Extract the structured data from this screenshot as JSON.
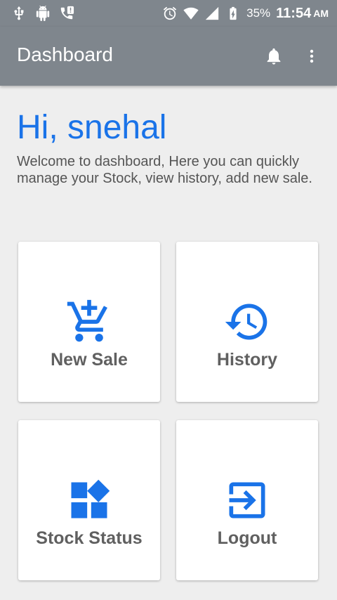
{
  "status_bar": {
    "battery": "35%",
    "time": "11:54",
    "ampm": "AM",
    "icons": [
      "usb-icon",
      "android-icon",
      "missed-call-icon",
      "alarm-icon",
      "wifi-icon",
      "signal-icon",
      "battery-charging-icon"
    ]
  },
  "app_bar": {
    "title": "Dashboard",
    "icons": [
      "notifications-icon",
      "more-vert-icon"
    ]
  },
  "greeting": "Hi, snehal",
  "welcome": "Welcome to dashboard, Here you can quickly manage your Stock, view history, add new sale.",
  "accent": "#1a73e8",
  "tiles": [
    {
      "label": "New Sale",
      "icon": "add-shopping-cart-icon"
    },
    {
      "label": "History",
      "icon": "history-icon"
    },
    {
      "label": "Stock Status",
      "icon": "widgets-icon"
    },
    {
      "label": "Logout",
      "icon": "exit-to-app-icon"
    }
  ]
}
